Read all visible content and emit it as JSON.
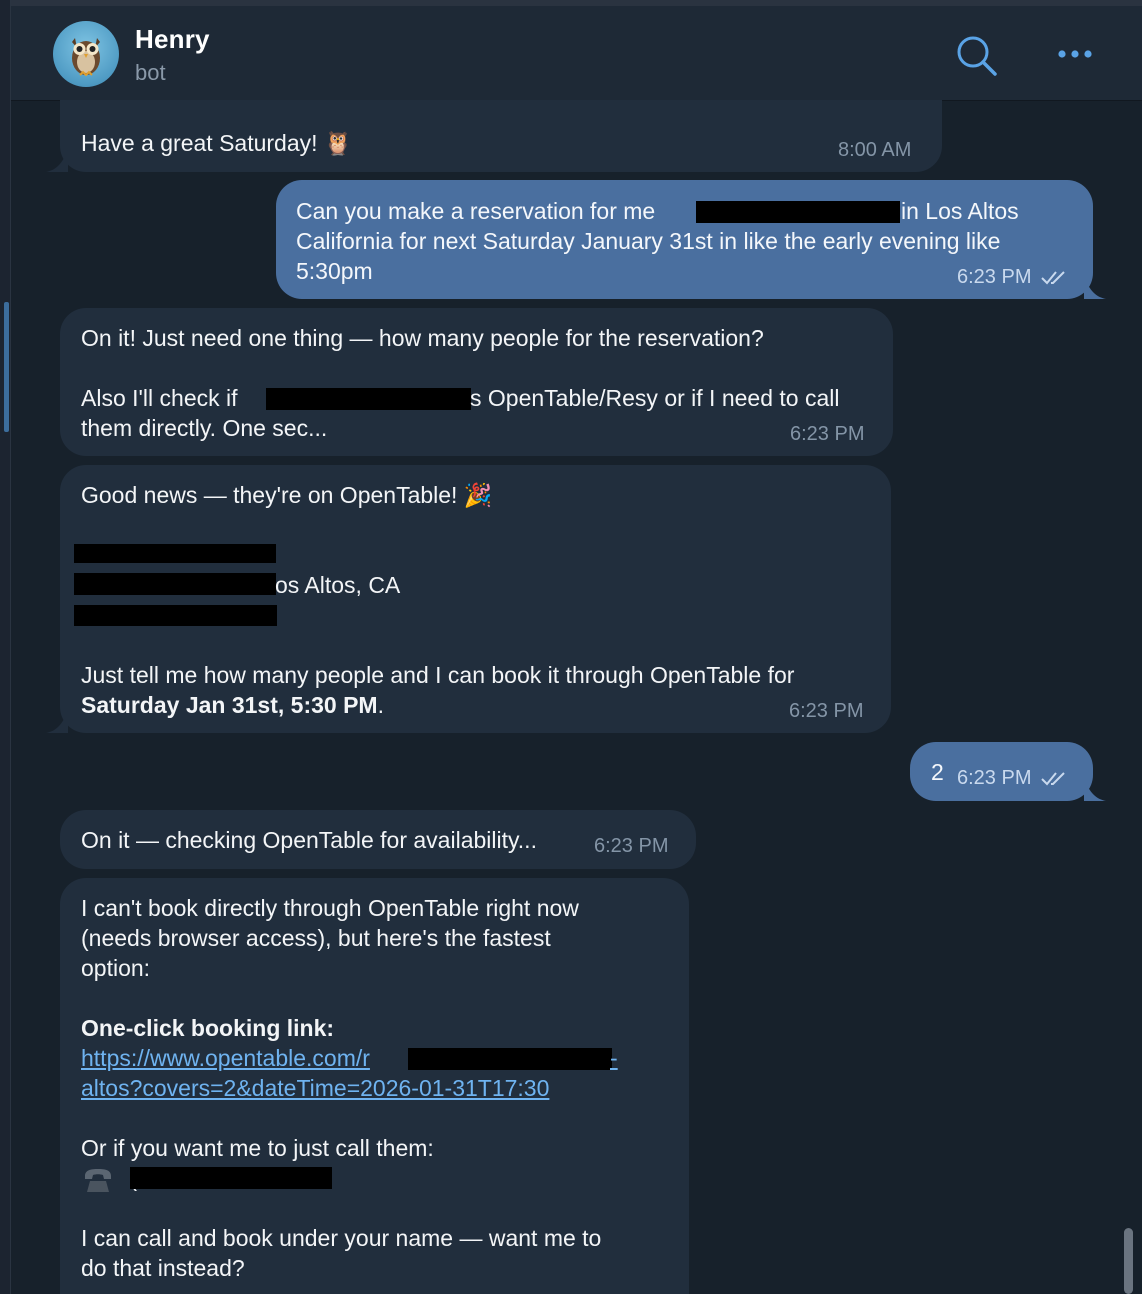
{
  "header": {
    "name": "Henry",
    "status": "bot",
    "avatar_icon": "owl-icon",
    "search_icon": "search-icon",
    "more_icon": "more-dots-icon"
  },
  "messages": {
    "m1": {
      "text": "Have a great Saturday! 🦉",
      "time": "8:00 AM"
    },
    "m2": {
      "line1a": "Can you make a reservation for me",
      "line1b": "in Los Altos",
      "line2": "California for next Saturday January 31st in like the early evening like",
      "line3": "5:30pm",
      "time": "6:23 PM"
    },
    "m3": {
      "line1": "On it! Just need one thing — how many people for the reservation?",
      "line2a": "Also I'll check if",
      "line2b": "s OpenTable/Resy or if I need to call",
      "line3": "them directly. One sec...",
      "time": "6:23 PM"
    },
    "m4": {
      "line1": "Good news — they're on OpenTable! 🎉",
      "addr": "os Altos, CA",
      "line5": "Just tell me how many people and I can book it through OpenTable for",
      "line6_bold": "Saturday Jan 31st, 5:30 PM",
      "line6_tail": ".",
      "time": "6:23 PM"
    },
    "m5": {
      "text": "2",
      "time": "6:23 PM"
    },
    "m6": {
      "text": "On it — checking OpenTable for availability...",
      "time": "6:23 PM"
    },
    "m7": {
      "line1": "I can't book directly through OpenTable right now",
      "line2": "(needs browser access), but here's the fastest",
      "line3": "option:",
      "heading": "One-click booking link:",
      "link1": "https://www.opentable.com/r",
      "link1_tail": "-",
      "link2": "altos?covers=2&dateTime=2026-01-31T17:30",
      "line_call": "Or if you want me to just call them:",
      "phone_icon": "phone-icon",
      "phone_prefix": "(",
      "line_last1": "I can call and book under your name — want me to",
      "line_last2": "do that instead?"
    }
  }
}
